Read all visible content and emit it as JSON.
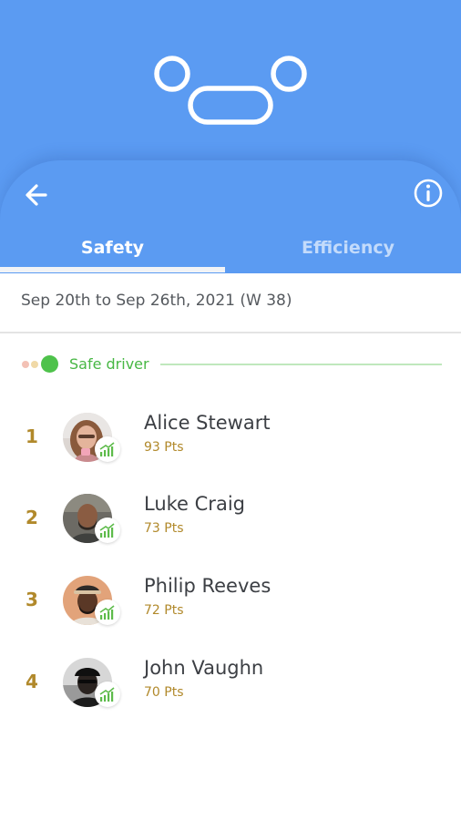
{
  "header": {
    "mascot_icon": "smiley-face-icon",
    "back_icon": "arrow-left-icon",
    "info_icon": "info-circle-icon"
  },
  "tabs": [
    {
      "label": "Safety",
      "active": true
    },
    {
      "label": "Efficiency",
      "active": false
    }
  ],
  "period": {
    "label": "Sep 20th to Sep 26th, 2021 (W 38)"
  },
  "level": {
    "label": "Safe driver",
    "colors": [
      "#f3c1b5",
      "#f0d9a7",
      "#4ec24b"
    ]
  },
  "leaderboard": [
    {
      "rank": "1",
      "name": "Alice Stewart",
      "points": "93 Pts",
      "badge_icon": "trending-up-bars-icon"
    },
    {
      "rank": "2",
      "name": "Luke Craig",
      "points": "73 Pts",
      "badge_icon": "trending-up-bars-icon"
    },
    {
      "rank": "3",
      "name": "Philip Reeves",
      "points": "72 Pts",
      "badge_icon": "trending-up-bars-icon"
    },
    {
      "rank": "4",
      "name": "John Vaughn",
      "points": "70 Pts",
      "badge_icon": "trending-up-bars-icon"
    }
  ],
  "colors": {
    "primary_blue": "#5b9bf2",
    "gold": "#b1892b",
    "green": "#4ec24b"
  }
}
